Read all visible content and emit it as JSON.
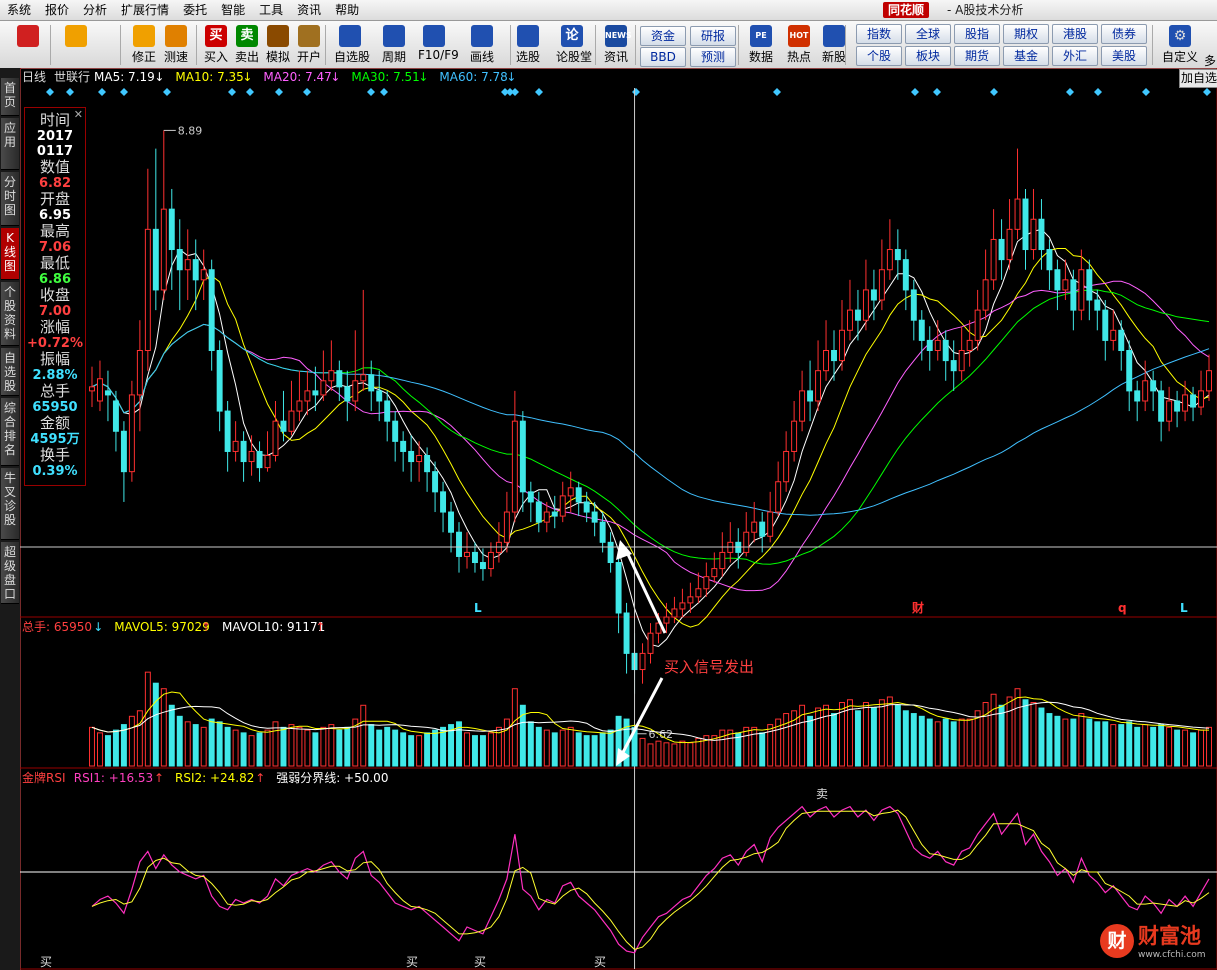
{
  "menu": [
    "系统",
    "报价",
    "分析",
    "扩展行情",
    "委托",
    "智能",
    "工具",
    "资讯",
    "帮助"
  ],
  "app": {
    "brand": "同花顺",
    "title": "- A股技术分析"
  },
  "toolbar": {
    "buttons": [
      {
        "label": "",
        "icon": "grid-icon",
        "color": "#d02020"
      },
      {
        "label": "",
        "icon": "back-arrow-icon",
        "color": "#f0a000"
      },
      {
        "label": "修正",
        "icon": "up-down-arrows-icon",
        "color": "#f0a000"
      },
      {
        "label": "测速",
        "icon": "clock-icon",
        "color": "#e08000"
      },
      {
        "label": "买入",
        "icon": "buy-icon",
        "color": "#cc0000",
        "glyph": "买"
      },
      {
        "label": "卖出",
        "icon": "sell-icon",
        "color": "#008800",
        "glyph": "卖"
      },
      {
        "label": "模拟",
        "icon": "hammer-icon",
        "color": "#8a4a00"
      },
      {
        "label": "开户",
        "icon": "lock-icon",
        "color": "#a07020"
      },
      {
        "label": "自选股",
        "icon": "star-icon",
        "color": "#2050b0"
      },
      {
        "label": "周期",
        "icon": "cycle-icon",
        "color": "#2050b0"
      },
      {
        "label": "F10/F9",
        "icon": "f10-icon",
        "color": "#2050b0"
      },
      {
        "label": "画线",
        "icon": "pen-icon",
        "color": "#2050b0"
      },
      {
        "label": "选股",
        "icon": "monitor-icon",
        "color": "#2050b0"
      },
      {
        "label": "论股堂",
        "icon": "forum-icon",
        "color": "#2050b0",
        "glyph": "论"
      },
      {
        "label": "资讯",
        "icon": "news-icon",
        "color": "#1a4aa0",
        "glyph": "NEWS"
      }
    ],
    "quick_row1": [
      "资金",
      "研报"
    ],
    "quick_row2": [
      "BBD",
      "预测"
    ],
    "buttons2": [
      {
        "label": "数据",
        "icon": "pe-icon",
        "glyph": "PE",
        "color": "#2050b0"
      },
      {
        "label": "热点",
        "icon": "hot-icon",
        "glyph": "HOT",
        "color": "#d03000"
      },
      {
        "label": "新股",
        "icon": "new-stock-icon",
        "color": "#2050b0"
      }
    ],
    "market_row1": [
      "指数",
      "全球",
      "股指",
      "期权",
      "港股",
      "债券"
    ],
    "market_row2": [
      "个股",
      "板块",
      "期货",
      "基金",
      "外汇",
      "美股"
    ],
    "custom_label": "自定义",
    "more_label": "多"
  },
  "sidebar": [
    "首页",
    "应用",
    "分时图",
    "K线图",
    "个股资料",
    "自选股",
    "综合排名",
    "牛叉诊股",
    "超级盘口"
  ],
  "sidebar_active": 3,
  "add_fav": "加自选",
  "price_header": {
    "period": "日线",
    "stock": "世联行",
    "items": [
      {
        "label": "MA5: 7.19",
        "dir": "↓",
        "color": "#ffffff"
      },
      {
        "label": "MA10: 7.35",
        "dir": "↓",
        "color": "#ffff00"
      },
      {
        "label": "MA20: 7.47",
        "dir": "↓",
        "color": "#ff60ff"
      },
      {
        "label": "MA30: 7.51",
        "dir": "↓",
        "color": "#00ff00"
      },
      {
        "label": "MA60: 7.78",
        "dir": "↓",
        "color": "#40c0ff"
      }
    ]
  },
  "info_panel": [
    {
      "label": "时间",
      "value": "2017",
      "value2": "0117",
      "color": "#ffffff"
    },
    {
      "label": "数值",
      "value": "6.82",
      "color": "#ff4040"
    },
    {
      "label": "开盘",
      "value": "6.95",
      "color": "#ffffff"
    },
    {
      "label": "最高",
      "value": "7.06",
      "color": "#ff4040"
    },
    {
      "label": "最低",
      "value": "6.86",
      "color": "#40ff40"
    },
    {
      "label": "收盘",
      "value": "7.00",
      "color": "#ff4040"
    },
    {
      "label": "涨幅",
      "value": "+0.72%",
      "color": "#ff4040"
    },
    {
      "label": "振幅",
      "value": "2.88%",
      "color": "#40e0ff"
    },
    {
      "label": "总手",
      "value": "65950",
      "color": "#40e0ff"
    },
    {
      "label": "金额",
      "value": "4595万",
      "color": "#40e0ff"
    },
    {
      "label": "换手",
      "value": "0.39%",
      "color": "#40e0ff"
    }
  ],
  "annotations": {
    "high": "8.89",
    "low": "6.62",
    "signal_text": "买入信号发出",
    "markers": [
      {
        "text": "L",
        "color": "#40e0ff"
      },
      {
        "text": "财",
        "color": "#ff3030"
      },
      {
        "text": "q",
        "color": "#ff3030"
      },
      {
        "text": "L",
        "color": "#40e0ff"
      }
    ]
  },
  "volume_header": [
    {
      "label": "总手: 65950",
      "dir": "↓",
      "color": "#ff4040",
      "dircolor": "#40e0ff"
    },
    {
      "label": "MAVOL5: 97029",
      "dir": "↑",
      "color": "#ffff00",
      "dircolor": "#ff4040"
    },
    {
      "label": "MAVOL10: 91171",
      "dir": "↑",
      "color": "#ffffff",
      "dircolor": "#ff4040"
    }
  ],
  "rsi_header": [
    {
      "label": "金牌RSI",
      "color": "#ff4040"
    },
    {
      "label": "RSI1: +16.53",
      "dir": "↑",
      "color": "#ff40c0",
      "dircolor": "#ff4040"
    },
    {
      "label": "RSI2: +24.82",
      "dir": "↑",
      "color": "#ffff00",
      "dircolor": "#ff4040"
    },
    {
      "label": "强弱分界线: +50.00",
      "color": "#ffffff"
    }
  ],
  "rsi_signals": {
    "buy": "买",
    "sell": "卖"
  },
  "watermark": {
    "glyph": "财",
    "name": "财富池",
    "url": "www.cfchi.com"
  },
  "chart_data": {
    "type": "candlestick",
    "price_range": [
      6.5,
      9.1
    ],
    "volume_range": [
      0,
      250000
    ],
    "rsi_range": [
      0,
      100
    ],
    "ma_labels": [
      "MA5",
      "MA10",
      "MA20",
      "MA30",
      "MA60"
    ],
    "candles": [
      [
        7.6,
        7.62,
        7.72,
        7.52,
        70
      ],
      [
        7.55,
        7.66,
        7.75,
        7.5,
        60
      ],
      [
        7.6,
        7.58,
        7.7,
        7.45,
        55
      ],
      [
        7.55,
        7.4,
        7.6,
        7.3,
        65
      ],
      [
        7.4,
        7.2,
        7.45,
        7.05,
        75
      ],
      [
        7.2,
        7.58,
        7.65,
        7.15,
        90
      ],
      [
        7.58,
        7.8,
        7.95,
        7.4,
        100
      ],
      [
        7.8,
        8.4,
        8.7,
        7.7,
        170
      ],
      [
        8.4,
        8.1,
        8.8,
        8.0,
        150
      ],
      [
        8.1,
        8.5,
        8.89,
        8.05,
        140
      ],
      [
        8.5,
        8.3,
        8.6,
        8.1,
        110
      ],
      [
        8.3,
        8.2,
        8.45,
        8.0,
        90
      ],
      [
        8.2,
        8.25,
        8.4,
        8.05,
        80
      ],
      [
        8.25,
        8.15,
        8.35,
        8.0,
        75
      ],
      [
        8.15,
        8.2,
        8.3,
        8.05,
        70
      ],
      [
        8.2,
        7.8,
        8.25,
        7.7,
        85
      ],
      [
        7.8,
        7.5,
        7.85,
        7.4,
        80
      ],
      [
        7.5,
        7.3,
        7.55,
        7.2,
        70
      ],
      [
        7.3,
        7.35,
        7.45,
        7.25,
        65
      ],
      [
        7.35,
        7.25,
        7.4,
        7.15,
        60
      ],
      [
        7.25,
        7.3,
        7.38,
        7.18,
        55
      ],
      [
        7.3,
        7.22,
        7.35,
        7.15,
        60
      ],
      [
        7.22,
        7.28,
        7.4,
        7.2,
        65
      ],
      [
        7.28,
        7.45,
        7.55,
        7.25,
        80
      ],
      [
        7.45,
        7.4,
        7.6,
        7.35,
        70
      ],
      [
        7.4,
        7.5,
        7.65,
        7.38,
        75
      ],
      [
        7.5,
        7.55,
        7.7,
        7.45,
        70
      ],
      [
        7.55,
        7.6,
        7.7,
        7.48,
        65
      ],
      [
        7.6,
        7.58,
        7.72,
        7.5,
        60
      ],
      [
        7.58,
        7.65,
        7.8,
        7.55,
        70
      ],
      [
        7.65,
        7.7,
        7.85,
        7.6,
        75
      ],
      [
        7.7,
        7.62,
        7.75,
        7.55,
        65
      ],
      [
        7.62,
        7.55,
        7.7,
        7.45,
        70
      ],
      [
        7.55,
        7.65,
        7.9,
        7.5,
        85
      ],
      [
        7.65,
        7.68,
        8.1,
        7.6,
        110
      ],
      [
        7.68,
        7.6,
        7.75,
        7.5,
        75
      ],
      [
        7.6,
        7.55,
        7.7,
        7.45,
        65
      ],
      [
        7.55,
        7.45,
        7.6,
        7.35,
        70
      ],
      [
        7.45,
        7.35,
        7.5,
        7.25,
        65
      ],
      [
        7.35,
        7.3,
        7.4,
        7.2,
        60
      ],
      [
        7.3,
        7.25,
        7.38,
        7.15,
        55
      ],
      [
        7.25,
        7.28,
        7.35,
        7.15,
        55
      ],
      [
        7.28,
        7.2,
        7.32,
        7.1,
        60
      ],
      [
        7.2,
        7.1,
        7.25,
        7.0,
        65
      ],
      [
        7.1,
        7.0,
        7.15,
        6.9,
        70
      ],
      [
        7.0,
        6.9,
        7.05,
        6.8,
        75
      ],
      [
        6.9,
        6.78,
        6.95,
        6.7,
        80
      ],
      [
        6.78,
        6.8,
        6.9,
        6.72,
        60
      ],
      [
        6.8,
        6.75,
        6.85,
        6.7,
        55
      ],
      [
        6.75,
        6.72,
        6.82,
        6.66,
        55
      ],
      [
        6.72,
        6.8,
        6.85,
        6.68,
        60
      ],
      [
        6.8,
        6.85,
        6.95,
        6.75,
        70
      ],
      [
        6.85,
        7.0,
        7.1,
        6.8,
        85
      ],
      [
        7.0,
        7.45,
        7.6,
        6.95,
        140
      ],
      [
        7.45,
        7.1,
        7.5,
        7.0,
        110
      ],
      [
        7.1,
        7.05,
        7.15,
        6.95,
        80
      ],
      [
        7.05,
        6.95,
        7.1,
        6.9,
        70
      ],
      [
        6.95,
        7.0,
        7.05,
        6.9,
        65
      ],
      [
        7.0,
        6.98,
        7.08,
        6.92,
        60
      ],
      [
        6.98,
        7.08,
        7.15,
        6.95,
        65
      ],
      [
        7.08,
        7.12,
        7.2,
        7.0,
        70
      ],
      [
        7.12,
        7.05,
        7.15,
        6.98,
        60
      ],
      [
        7.05,
        7.0,
        7.1,
        6.95,
        55
      ],
      [
        7.0,
        6.95,
        7.05,
        6.88,
        55
      ],
      [
        6.95,
        6.85,
        7.0,
        6.8,
        60
      ],
      [
        6.85,
        6.75,
        6.9,
        6.7,
        65
      ],
      [
        6.75,
        6.5,
        6.8,
        6.4,
        90
      ],
      [
        6.5,
        6.3,
        6.55,
        6.2,
        85
      ],
      [
        6.3,
        6.22,
        6.4,
        6.1,
        70
      ],
      [
        6.22,
        6.3,
        6.35,
        6.15,
        50
      ],
      [
        6.3,
        6.4,
        6.45,
        6.25,
        40
      ],
      [
        6.4,
        6.45,
        6.5,
        6.35,
        45
      ],
      [
        6.45,
        6.48,
        6.55,
        6.4,
        42
      ],
      [
        6.48,
        6.52,
        6.58,
        6.45,
        40
      ],
      [
        6.52,
        6.55,
        6.62,
        6.48,
        45
      ],
      [
        6.55,
        6.58,
        6.65,
        6.5,
        42
      ],
      [
        6.58,
        6.62,
        6.7,
        6.55,
        50
      ],
      [
        6.62,
        6.68,
        6.75,
        6.58,
        55
      ],
      [
        6.68,
        6.72,
        6.8,
        6.65,
        55
      ],
      [
        6.72,
        6.8,
        6.9,
        6.68,
        65
      ],
      [
        6.8,
        6.85,
        6.95,
        6.75,
        65
      ],
      [
        6.85,
        6.8,
        6.92,
        6.72,
        60
      ],
      [
        6.8,
        6.9,
        7.0,
        6.78,
        70
      ],
      [
        6.9,
        6.95,
        7.05,
        6.85,
        70
      ],
      [
        6.95,
        6.88,
        7.0,
        6.8,
        60
      ],
      [
        6.88,
        7.0,
        7.1,
        6.85,
        75
      ],
      [
        7.0,
        7.15,
        7.25,
        6.98,
        85
      ],
      [
        7.15,
        7.3,
        7.4,
        7.1,
        95
      ],
      [
        7.3,
        7.45,
        7.55,
        7.25,
        100
      ],
      [
        7.45,
        7.6,
        7.7,
        7.4,
        110
      ],
      [
        7.6,
        7.55,
        7.75,
        7.45,
        90
      ],
      [
        7.55,
        7.7,
        7.85,
        7.5,
        105
      ],
      [
        7.7,
        7.8,
        7.95,
        7.65,
        110
      ],
      [
        7.8,
        7.75,
        7.9,
        7.65,
        95
      ],
      [
        7.75,
        7.9,
        8.05,
        7.7,
        115
      ],
      [
        7.9,
        8.0,
        8.15,
        7.85,
        120
      ],
      [
        8.0,
        7.95,
        8.1,
        7.85,
        100
      ],
      [
        7.95,
        8.1,
        8.25,
        7.9,
        115
      ],
      [
        8.1,
        8.05,
        8.2,
        7.95,
        105
      ],
      [
        8.05,
        8.2,
        8.35,
        8.0,
        120
      ],
      [
        8.2,
        8.3,
        8.45,
        8.15,
        125
      ],
      [
        8.3,
        8.25,
        8.4,
        8.15,
        110
      ],
      [
        8.25,
        8.1,
        8.3,
        8.0,
        100
      ],
      [
        8.1,
        7.95,
        8.15,
        7.85,
        95
      ],
      [
        7.95,
        7.85,
        8.0,
        7.75,
        90
      ],
      [
        7.85,
        7.8,
        7.92,
        7.7,
        85
      ],
      [
        7.8,
        7.85,
        7.95,
        7.75,
        80
      ],
      [
        7.85,
        7.75,
        7.9,
        7.65,
        85
      ],
      [
        7.75,
        7.7,
        7.85,
        7.6,
        80
      ],
      [
        7.7,
        7.8,
        7.92,
        7.65,
        85
      ],
      [
        7.8,
        7.85,
        7.95,
        7.72,
        85
      ],
      [
        7.85,
        8.0,
        8.1,
        7.8,
        100
      ],
      [
        8.0,
        8.15,
        8.3,
        7.95,
        115
      ],
      [
        8.15,
        8.35,
        8.5,
        8.1,
        130
      ],
      [
        8.35,
        8.25,
        8.45,
        8.15,
        110
      ],
      [
        8.25,
        8.4,
        8.55,
        8.2,
        125
      ],
      [
        8.4,
        8.55,
        8.8,
        8.35,
        140
      ],
      [
        8.55,
        8.3,
        8.6,
        8.2,
        120
      ],
      [
        8.3,
        8.45,
        8.6,
        8.25,
        115
      ],
      [
        8.45,
        8.3,
        8.55,
        8.2,
        105
      ],
      [
        8.3,
        8.2,
        8.35,
        8.1,
        95
      ],
      [
        8.2,
        8.1,
        8.25,
        8.0,
        90
      ],
      [
        8.1,
        8.15,
        8.25,
        8.05,
        85
      ],
      [
        8.15,
        8.0,
        8.2,
        7.9,
        85
      ],
      [
        8.0,
        8.2,
        8.3,
        7.95,
        95
      ],
      [
        8.2,
        8.05,
        8.25,
        7.95,
        85
      ],
      [
        8.05,
        8.0,
        8.1,
        7.9,
        80
      ],
      [
        8.0,
        7.85,
        8.05,
        7.75,
        80
      ],
      [
        7.85,
        7.9,
        8.0,
        7.8,
        75
      ],
      [
        7.9,
        7.8,
        7.95,
        7.7,
        75
      ],
      [
        7.8,
        7.6,
        7.85,
        7.5,
        80
      ],
      [
        7.6,
        7.55,
        7.65,
        7.45,
        70
      ],
      [
        7.55,
        7.65,
        7.75,
        7.5,
        75
      ],
      [
        7.65,
        7.6,
        7.7,
        7.5,
        70
      ],
      [
        7.6,
        7.45,
        7.65,
        7.35,
        75
      ],
      [
        7.45,
        7.55,
        7.62,
        7.4,
        70
      ],
      [
        7.55,
        7.5,
        7.6,
        7.42,
        65
      ],
      [
        7.5,
        7.58,
        7.65,
        7.45,
        65
      ],
      [
        7.58,
        7.52,
        7.62,
        7.45,
        60
      ],
      [
        7.52,
        7.6,
        7.7,
        7.48,
        65
      ],
      [
        7.6,
        7.7,
        7.78,
        7.55,
        70
      ]
    ],
    "rsi1": [
      30,
      34,
      36,
      32,
      26,
      40,
      56,
      62,
      52,
      60,
      54,
      50,
      48,
      46,
      48,
      36,
      30,
      28,
      34,
      32,
      34,
      32,
      36,
      46,
      42,
      48,
      50,
      52,
      50,
      54,
      56,
      50,
      46,
      58,
      62,
      48,
      44,
      38,
      32,
      30,
      28,
      30,
      26,
      22,
      18,
      14,
      10,
      18,
      16,
      14,
      24,
      34,
      46,
      72,
      40,
      36,
      28,
      34,
      32,
      42,
      44,
      36,
      32,
      28,
      22,
      16,
      8,
      4,
      3,
      12,
      18,
      24,
      26,
      30,
      34,
      36,
      42,
      48,
      52,
      58,
      60,
      54,
      62,
      66,
      56,
      70,
      76,
      80,
      84,
      88,
      82,
      86,
      88,
      82,
      86,
      88,
      82,
      86,
      80,
      86,
      88,
      84,
      74,
      64,
      60,
      58,
      62,
      56,
      54,
      62,
      64,
      72,
      78,
      84,
      72,
      78,
      84,
      66,
      72,
      62,
      56,
      48,
      52,
      44,
      58,
      48,
      44,
      38,
      42,
      36,
      30,
      28,
      36,
      32,
      26,
      34,
      30,
      36,
      30,
      38,
      46
    ]
  }
}
